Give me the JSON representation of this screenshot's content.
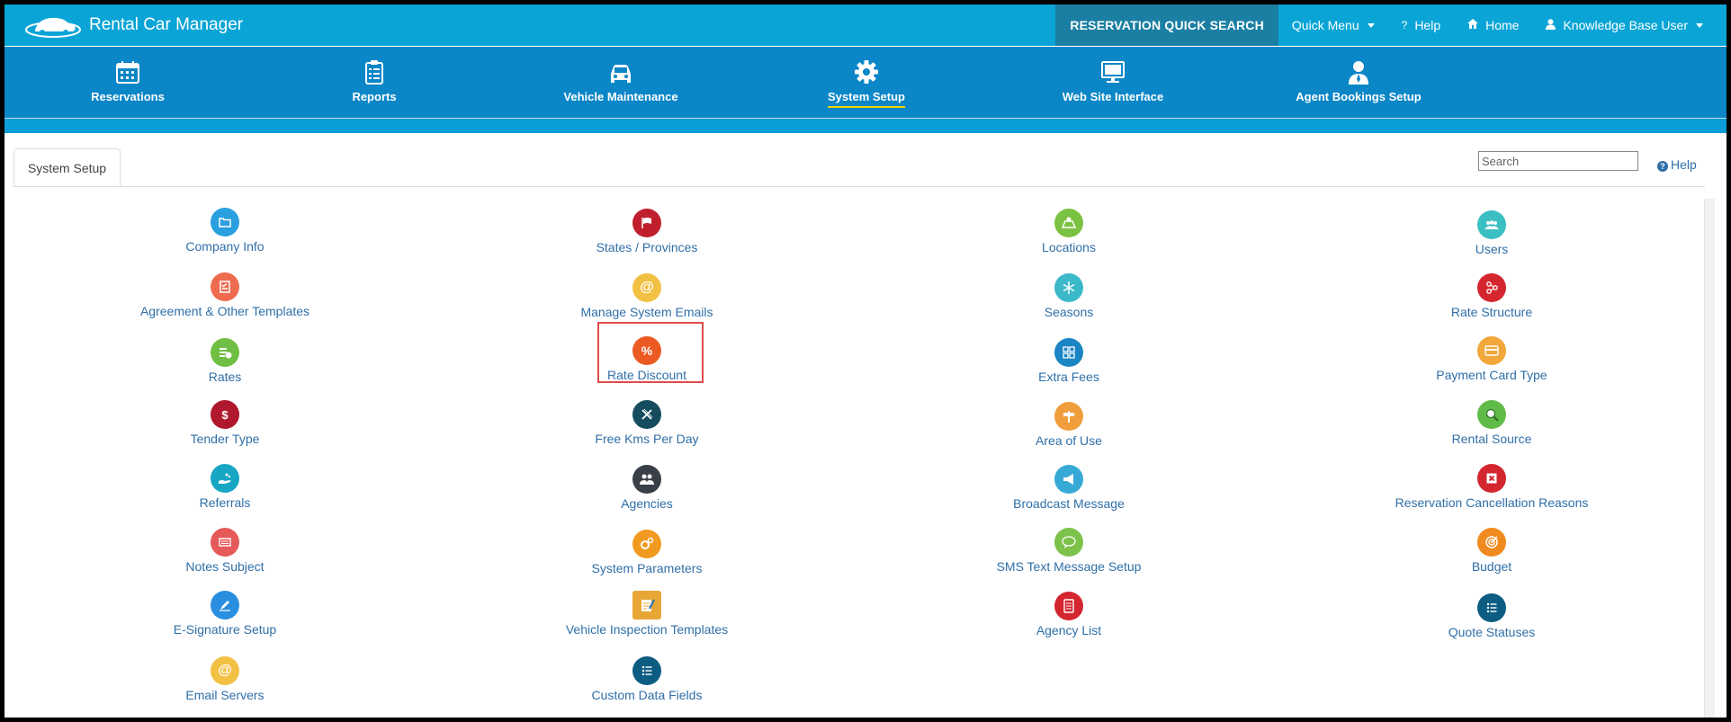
{
  "app": {
    "title": "Rental Car Manager"
  },
  "topnav": {
    "quick_search": "RESERVATION QUICK SEARCH",
    "quick_menu": "Quick Menu",
    "help": "Help",
    "home": "Home",
    "user": "Knowledge Base User"
  },
  "mainnav": {
    "items": [
      {
        "label": "Reservations",
        "icon": "calendar-icon"
      },
      {
        "label": "Reports",
        "icon": "clipboard-icon"
      },
      {
        "label": "Vehicle Maintenance",
        "icon": "car-icon"
      },
      {
        "label": "System Setup",
        "icon": "gear-icon",
        "active": true
      },
      {
        "label": "Web Site Interface",
        "icon": "monitor-icon"
      },
      {
        "label": "Agent Bookings Setup",
        "icon": "agent-icon"
      }
    ]
  },
  "tab": {
    "label": "System Setup"
  },
  "search": {
    "placeholder": "Search"
  },
  "help_link": "Help",
  "highlight_color": "#e04a4a",
  "tiles": {
    "c1": [
      {
        "label": "Company Info",
        "icon": "folder-icon",
        "color": "#2a9fe0"
      },
      {
        "label": "Agreement & Other Templates",
        "icon": "checklist-icon",
        "color": "#ef6b4f"
      },
      {
        "label": "Rates",
        "icon": "money-icon",
        "color": "#6fbf44"
      },
      {
        "label": "Tender Type",
        "icon": "money-bag-icon",
        "color": "#b0182d"
      },
      {
        "label": "Referrals",
        "icon": "hand-icon",
        "color": "#17a6c4"
      },
      {
        "label": "Notes Subject",
        "icon": "notes-icon",
        "color": "#e65a5a"
      },
      {
        "label": "E-Signature Setup",
        "icon": "pen-icon",
        "color": "#2a8ee0"
      },
      {
        "label": "Email Servers",
        "icon": "at-icon",
        "color": "#f2c043"
      }
    ],
    "c2": [
      {
        "label": "States / Provinces",
        "icon": "flag-icon",
        "color": "#c0202e"
      },
      {
        "label": "Manage System Emails",
        "icon": "at-icon",
        "color": "#f2c043"
      },
      {
        "label": "Rate Discount",
        "icon": "percent-icon",
        "color": "#ec5a24"
      },
      {
        "label": "Free Kms Per Day",
        "icon": "road-icon",
        "color": "#154c5e"
      },
      {
        "label": "Agencies",
        "icon": "people-icon",
        "color": "#3a4048"
      },
      {
        "label": "System Parameters",
        "icon": "gears-icon",
        "color": "#f29a1f"
      },
      {
        "label": "Vehicle Inspection Templates",
        "icon": "clipboard-pencil-icon",
        "color": "#e8a735"
      },
      {
        "label": "Custom Data Fields",
        "icon": "list-icon",
        "color": "#0d5d82"
      }
    ],
    "c3": [
      {
        "label": "Locations",
        "icon": "map-icon",
        "color": "#7cc242"
      },
      {
        "label": "Seasons",
        "icon": "snowflake-icon",
        "color": "#3cb9c9"
      },
      {
        "label": "Extra Fees",
        "icon": "calculator-icon",
        "color": "#1b85c3"
      },
      {
        "label": "Area of Use",
        "icon": "signpost-icon",
        "color": "#f09e3c"
      },
      {
        "label": "Broadcast Message",
        "icon": "megaphone-icon",
        "color": "#36a9d6"
      },
      {
        "label": "SMS Text Message Setup",
        "icon": "sms-icon",
        "color": "#7dc24a"
      },
      {
        "label": "Agency List",
        "icon": "document-icon",
        "color": "#d4262f"
      }
    ],
    "c4": [
      {
        "label": "Users",
        "icon": "users-icon",
        "color": "#3bbfc2"
      },
      {
        "label": "Rate Structure",
        "icon": "structure-icon",
        "color": "#d4262f"
      },
      {
        "label": "Payment Card Type",
        "icon": "card-icon",
        "color": "#f2a73a"
      },
      {
        "label": "Rental Source",
        "icon": "magnifier-icon",
        "color": "#5fbb48"
      },
      {
        "label": "Reservation Cancellation Reasons",
        "icon": "cancel-icon",
        "color": "#d4262f"
      },
      {
        "label": "Budget",
        "icon": "target-icon",
        "color": "#f08a1f"
      },
      {
        "label": "Quote Statuses",
        "icon": "list-icon",
        "color": "#0d5d82"
      }
    ]
  }
}
